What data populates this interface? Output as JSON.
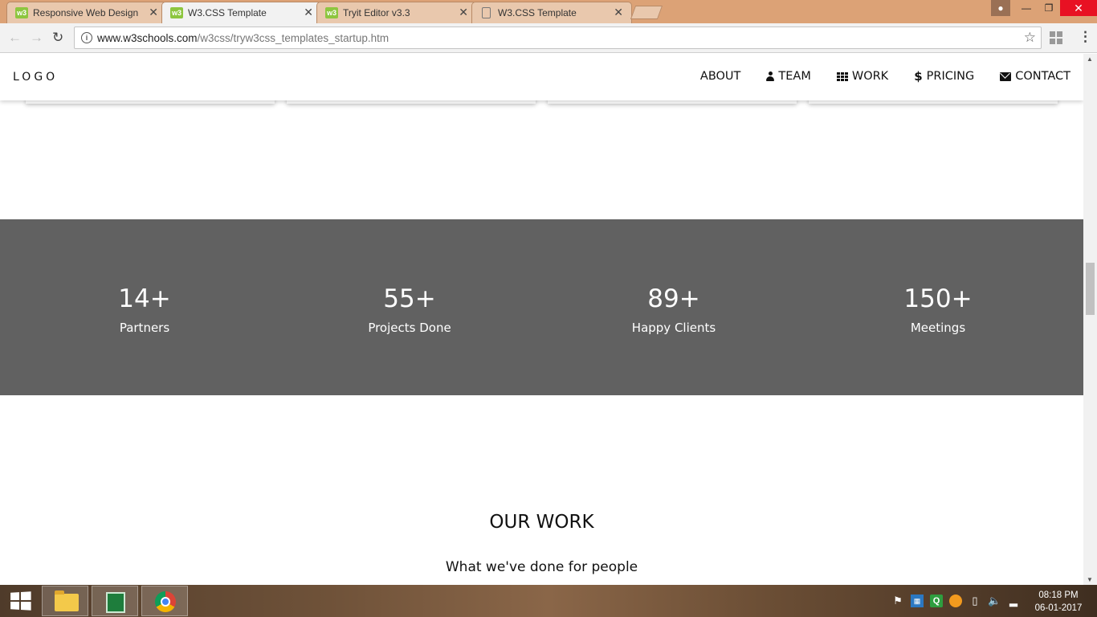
{
  "browser": {
    "tabs": [
      {
        "label": "Responsive Web Design",
        "favicon": "w3"
      },
      {
        "label": "W3.CSS Template",
        "favicon": "w3"
      },
      {
        "label": "Tryit Editor v3.3",
        "favicon": "w3"
      },
      {
        "label": "W3.CSS Template",
        "favicon": "doc"
      }
    ],
    "active_tab": 1,
    "close_glyph": "✕",
    "url_host": "www.w3schools.com",
    "url_path": "/w3css/tryw3css_templates_startup.htm"
  },
  "page": {
    "logo": "LOGO",
    "nav": [
      {
        "label": "ABOUT",
        "icon": ""
      },
      {
        "label": "TEAM",
        "icon": "user-icon"
      },
      {
        "label": "WORK",
        "icon": "th-grid-icon"
      },
      {
        "label": "PRICING",
        "icon": "dollar-icon"
      },
      {
        "label": "CONTACT",
        "icon": "envelope-icon"
      }
    ],
    "stats": [
      {
        "number": "14+",
        "label": "Partners"
      },
      {
        "number": "55+",
        "label": "Projects Done"
      },
      {
        "number": "89+",
        "label": "Happy Clients"
      },
      {
        "number": "150+",
        "label": "Meetings"
      }
    ],
    "stats_background": "#616161",
    "section_title": "OUR WORK",
    "section_subtitle": "What we've done for people"
  },
  "taskbar": {
    "apps": [
      "file-explorer",
      "spreadsheet",
      "chrome"
    ],
    "time": "08:18 PM",
    "date": "06-01-2017"
  }
}
